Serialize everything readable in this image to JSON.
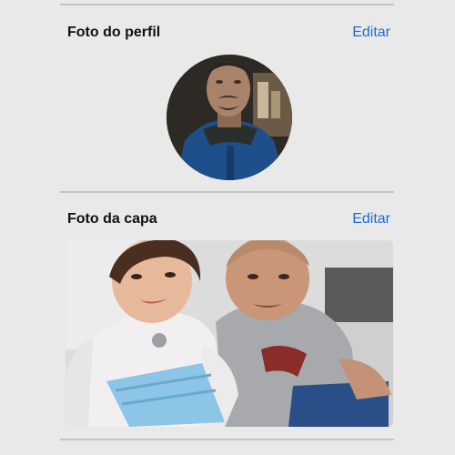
{
  "profile_photo": {
    "title": "Foto do perfil",
    "edit_label": "Editar"
  },
  "cover_photo": {
    "title": "Foto da capa",
    "edit_label": "Editar"
  },
  "colors": {
    "background": "#e9e9e9",
    "divider": "#c4c4c7",
    "title_text": "#111111",
    "link": "#1a6fd0"
  }
}
